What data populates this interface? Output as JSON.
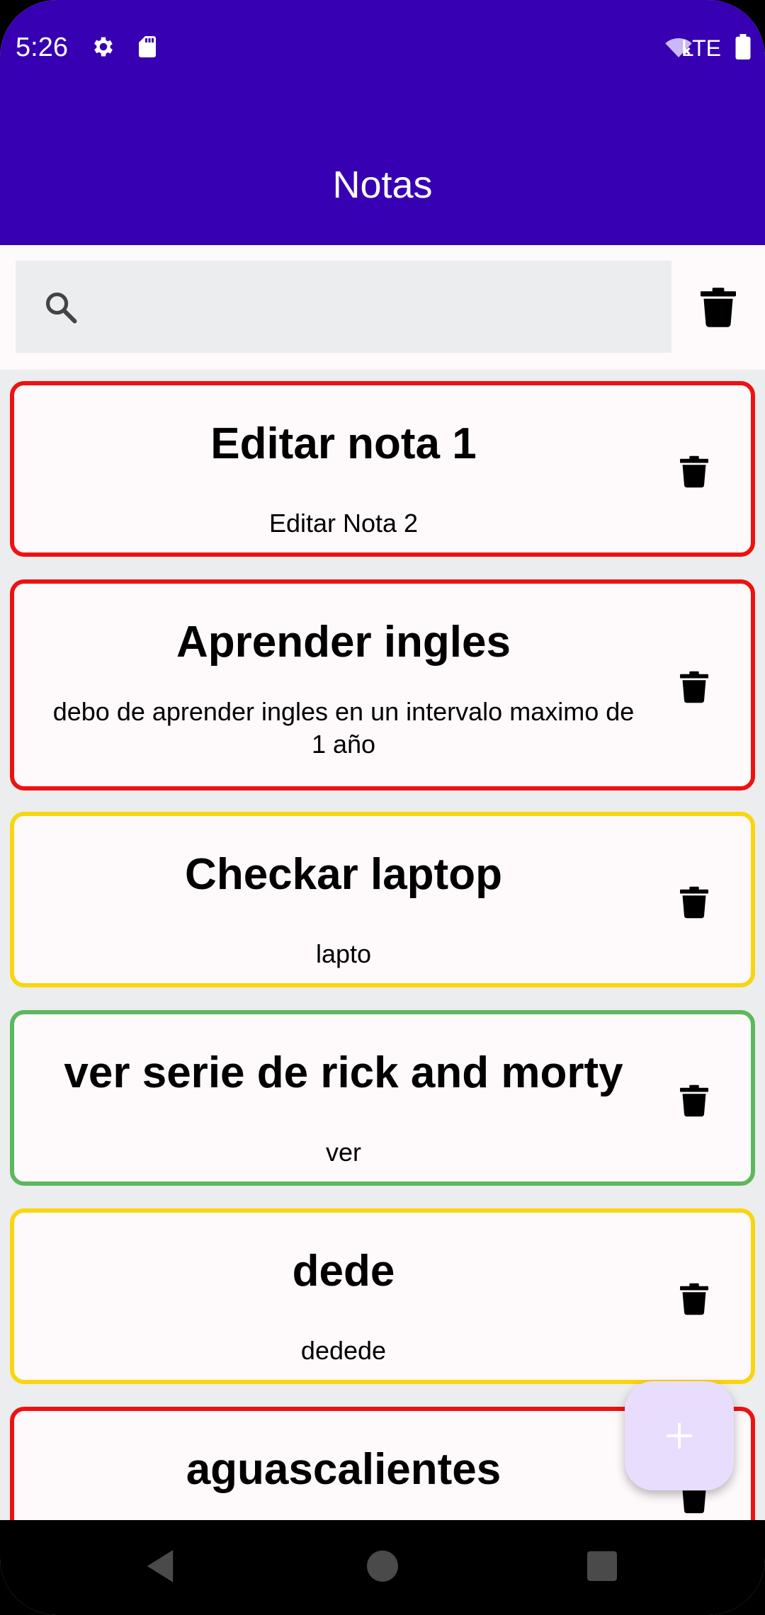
{
  "colors": {
    "app_bar": "#3700B3",
    "background": "#ECEDEE",
    "card_background": "#FEF9FB",
    "fab_background": "#E9DDFD",
    "priority_red": "#EE1111",
    "priority_yellow": "#F9D510",
    "priority_green": "#5CB85C"
  },
  "status_bar": {
    "time": "5:26",
    "network": "LTE",
    "icons": [
      "settings-icon",
      "sd-card-icon",
      "wifi-off-icon",
      "battery-icon"
    ]
  },
  "app_bar": {
    "title": "Notas"
  },
  "search": {
    "placeholder": "",
    "value": "",
    "icon": "search-icon",
    "delete_all_icon": "trash-icon"
  },
  "notes": [
    {
      "title": "Editar nota 1",
      "body": "Editar Nota 2",
      "priority_color": "#EE1111"
    },
    {
      "title": "Aprender ingles",
      "body": "debo de aprender ingles en un intervalo maximo de 1 año",
      "priority_color": "#EE1111"
    },
    {
      "title": "Checkar laptop",
      "body": "lapto",
      "priority_color": "#F9D510"
    },
    {
      "title": "ver serie de rick and morty",
      "body": "ver",
      "priority_color": "#5CB85C"
    },
    {
      "title": "dede",
      "body": "dedede",
      "priority_color": "#F9D510"
    },
    {
      "title": "aguascalientes",
      "body": "",
      "priority_color": "#EE1111"
    }
  ],
  "fab": {
    "icon": "plus-icon",
    "symbol": "+"
  },
  "nav_bar": {
    "buttons": [
      "back-icon",
      "home-icon",
      "recents-icon"
    ]
  }
}
